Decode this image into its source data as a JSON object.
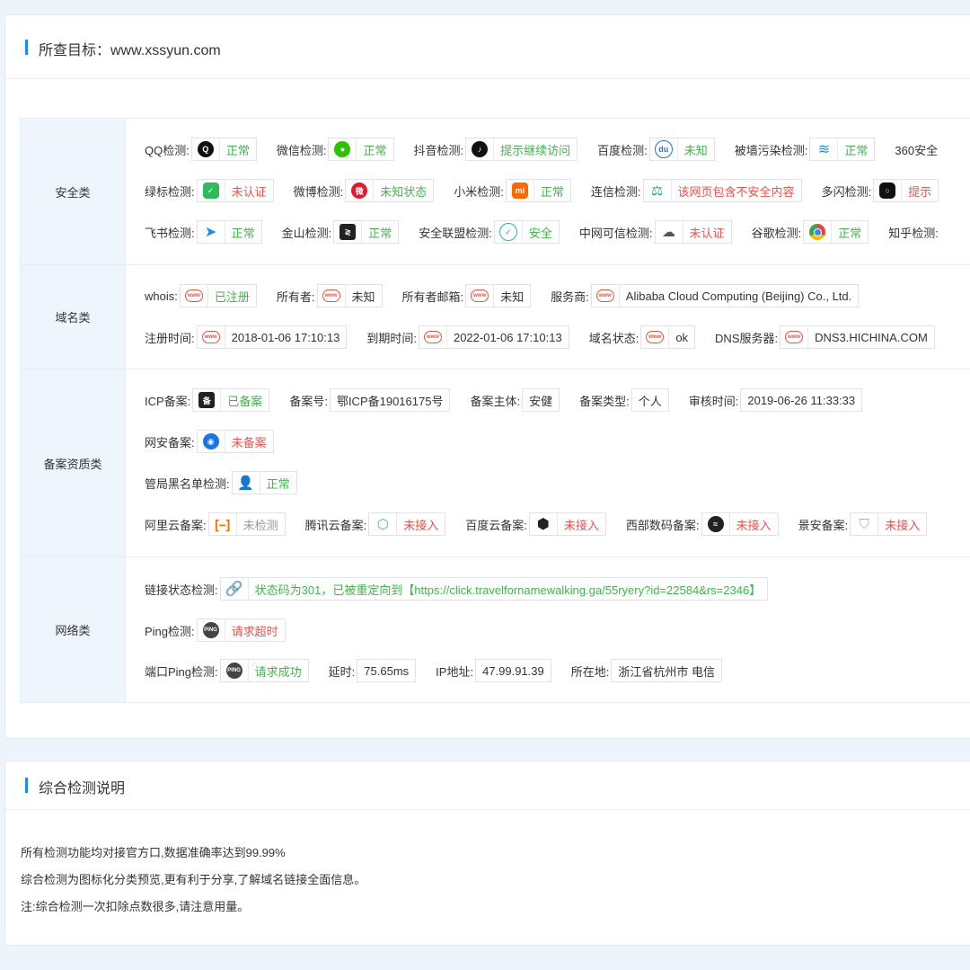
{
  "top_card": {
    "title": "所查目标：www.xssyun.com"
  },
  "security": {
    "category": "安全类",
    "items": [
      {
        "label": "QQ检测:",
        "icon": "qq-icon",
        "status": "正常"
      },
      {
        "label": "微信检测:",
        "icon": "wechat-icon",
        "status": "正常"
      },
      {
        "label": "抖音检测:",
        "icon": "douyin-icon",
        "status": "提示继续访问"
      },
      {
        "label": "百度检测:",
        "icon": "baidu-icon",
        "status": "未知"
      },
      {
        "label": "被墙污染检测:",
        "icon": "layers-icon",
        "status": "正常"
      },
      {
        "label": "360安全",
        "icon": "",
        "status": ""
      },
      {
        "label": "绿标检测:",
        "icon": "shield-check-icon",
        "status": "未认证"
      },
      {
        "label": "微博检测:",
        "icon": "weibo-icon",
        "status": "未知状态"
      },
      {
        "label": "小米检测:",
        "icon": "xiaomi-icon",
        "status": "正常"
      },
      {
        "label": "连信检测:",
        "icon": "judge-hammer-icon",
        "status": "该网页包含不安全内容"
      },
      {
        "label": "多闪检测:",
        "icon": "duoshan-icon",
        "status": "提示"
      },
      {
        "label": "飞书检测:",
        "icon": "feishu-icon",
        "status": "正常"
      },
      {
        "label": "金山检测:",
        "icon": "kingsoft-icon",
        "status": "正常"
      },
      {
        "label": "安全联盟检测:",
        "icon": "security-alliance-icon",
        "status": "安全"
      },
      {
        "label": "中网可信检测:",
        "icon": "cloud-icon",
        "status": "未认证"
      },
      {
        "label": "谷歌检测:",
        "icon": "chrome-icon",
        "status": "正常"
      },
      {
        "label": "知乎检测:",
        "icon": "",
        "status": ""
      }
    ]
  },
  "domain": {
    "category": "域名类",
    "items": [
      {
        "label": "whois:",
        "value": "已注册"
      },
      {
        "label": "所有者:",
        "value": "未知"
      },
      {
        "label": "所有者邮箱:",
        "value": "未知"
      },
      {
        "label": "服务商:",
        "value": "Alibaba Cloud Computing (Beijing) Co., Ltd."
      },
      {
        "label": "注册时间:",
        "value": "2018-01-06 17:10:13"
      },
      {
        "label": "到期时间:",
        "value": "2022-01-06 17:10:13"
      },
      {
        "label": "域名状态:",
        "value": "ok"
      },
      {
        "label": "DNS服务器:",
        "value": "DNS3.HICHINA.COM"
      }
    ],
    "www_icon": "www"
  },
  "filing": {
    "category": "备案资质类",
    "icp": {
      "label": "ICP备案:",
      "status": "已备案"
    },
    "icp_no": {
      "label": "备案号:",
      "value": "鄂ICP备19016175号"
    },
    "subject": {
      "label": "备案主体:",
      "value": "安健"
    },
    "type": {
      "label": "备案类型:",
      "value": "个人"
    },
    "review": {
      "label": "审核时间:",
      "value": "2019-06-26 11:33:33"
    },
    "police": {
      "label": "网安备案:",
      "status": "未备案"
    },
    "blacklist": {
      "label": "管局黑名单检测:",
      "status": "正常"
    },
    "aliyun": {
      "label": "阿里云备案:",
      "status": "未检测"
    },
    "tencent": {
      "label": "腾讯云备案:",
      "status": "未接入"
    },
    "baidu": {
      "label": "百度云备案:",
      "status": "未接入"
    },
    "west": {
      "label": "西部数码备案:",
      "status": "未接入"
    },
    "jingan": {
      "label": "景安备案:",
      "status": "未接入"
    }
  },
  "network": {
    "category": "网络类",
    "link": {
      "label": "链接状态检测:",
      "status": "状态码为301，已被重定向到【https://click.travelfornamewalking.ga/55ryery?id=22584&rs=2346】"
    },
    "ping": {
      "label": "Ping检测:",
      "status": "请求超时"
    },
    "port_ping": {
      "label": "端口Ping检测:",
      "status": "请求成功"
    },
    "latency": {
      "label": "延时:",
      "value": "75.65ms"
    },
    "ip": {
      "label": "IP地址:",
      "value": "47.99.91.39"
    },
    "location": {
      "label": "所在地:",
      "value": "浙江省杭州市 电信"
    },
    "ping_icon": "PING"
  },
  "bottom_card": {
    "title": "综合检测说明",
    "notes": [
      "所有检测功能均对接官方口,数据准确率达到99.99%",
      "综合检测为图标化分类预览,更有利于分享,了解域名链接全面信息。",
      "注:综合检测一次扣除点数很多,请注意用量。"
    ]
  },
  "colors": {
    "ok": "#3fb64a",
    "bad": "#f0504a",
    "accent": "#1a8cf0",
    "category_bg": "#eef5fd"
  }
}
